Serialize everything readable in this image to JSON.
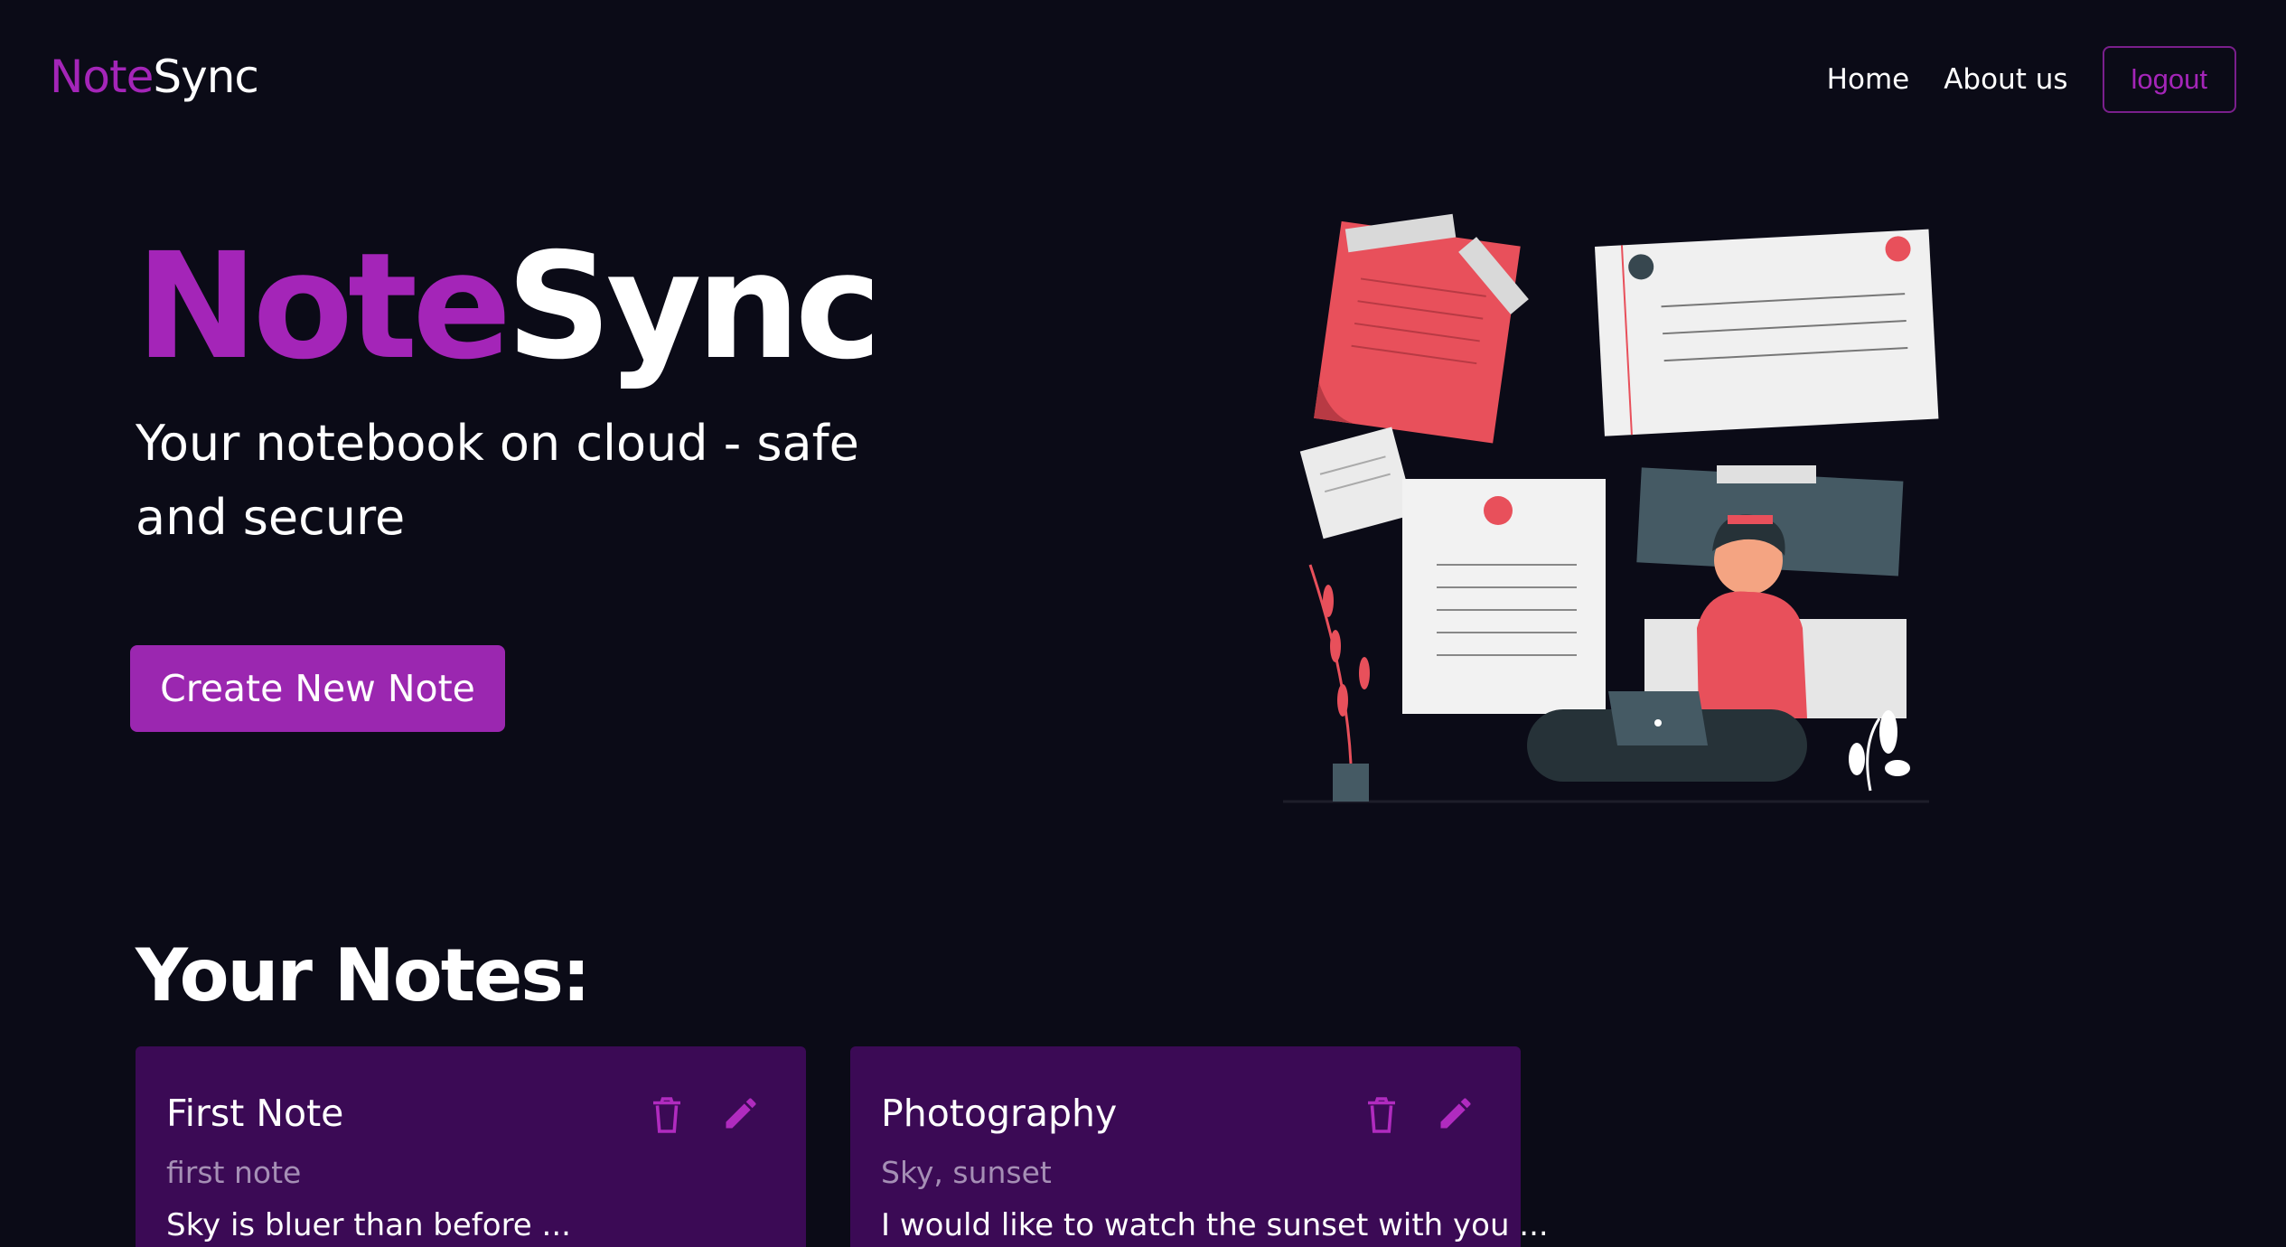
{
  "brand": {
    "part1": "Note",
    "part2": "Sync"
  },
  "nav": {
    "home": "Home",
    "about": "About us",
    "logout": "logout"
  },
  "hero": {
    "title_part1": "Note",
    "title_part2": "Sync",
    "subtitle": "Your notebook on cloud - safe and secure",
    "cta": "Create New Note"
  },
  "notes_section": {
    "title": "Your Notes:",
    "notes": [
      {
        "title": "First Note",
        "tag": "first note",
        "description": "Sky is bluer than before ...",
        "delete_icon": "trash-icon",
        "edit_icon": "pencil-icon"
      },
      {
        "title": "Photography",
        "tag": "Sky, sunset",
        "description": "I would like to watch the sunset with you ...",
        "delete_icon": "trash-icon",
        "edit_icon": "pencil-icon"
      }
    ]
  },
  "colors": {
    "background": "#0b0b17",
    "accent": "#9b27b0",
    "card": "#3b0a55"
  }
}
